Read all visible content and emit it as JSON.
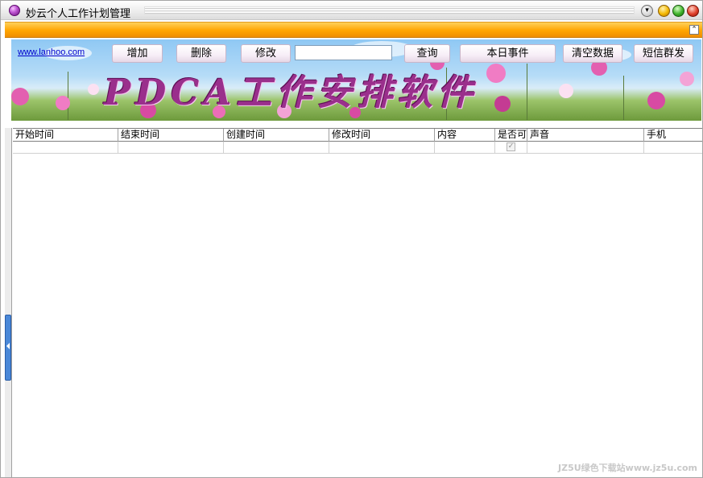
{
  "window": {
    "title": "妙云个人工作计划管理",
    "menu_glyph": "▾"
  },
  "toolbar": {
    "site_link": "www.lanhoo.com",
    "add_label": "增加",
    "delete_label": "删除",
    "edit_label": "修改",
    "search_value": "",
    "query_label": "查询",
    "today_events_label": "本日事件",
    "clear_data_label": "清空数据",
    "sms_label": "短信群发",
    "collapse_glyph": "⌃"
  },
  "banner": {
    "title": "PDCA工作安排软件"
  },
  "grid": {
    "columns": [
      "开始时间",
      "结束时间",
      "创建时间",
      "修改时间",
      "内容",
      "是否可",
      "声音",
      "手机"
    ],
    "rows": [
      {
        "start": "",
        "end": "",
        "created": "",
        "modified": "",
        "content": "",
        "enabled": true,
        "sound": "",
        "phone": ""
      }
    ],
    "check_glyph": "✓"
  },
  "watermark": "JZ5U绿色下载站www.jz5u.com",
  "colors": {
    "orange_band": "#ffa500",
    "banner_title": "#9a2f8c",
    "link": "#0000cc"
  }
}
